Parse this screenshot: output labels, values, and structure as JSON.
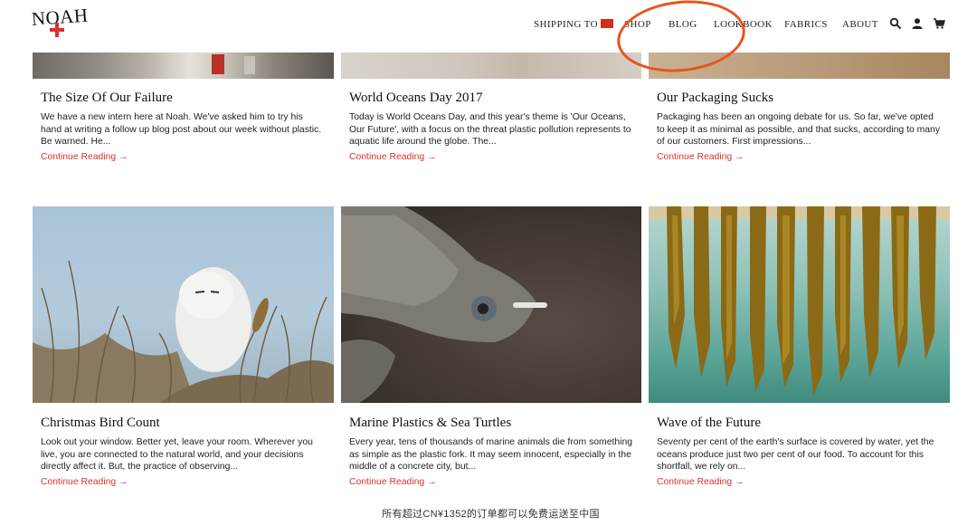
{
  "header": {
    "logo_text": "NOAH",
    "nav": {
      "shipping": "SHIPPING TO",
      "shop": "SHOP",
      "blog": "BLOG",
      "lookbook": "LOOKBOOK",
      "fabrics": "FABRICS",
      "about": "ABOUT"
    },
    "icons": [
      "search-icon",
      "account-icon",
      "cart-icon"
    ],
    "flag_color": "#d52b1e",
    "highlight_color": "#e8541d"
  },
  "articles_top": [
    {
      "title": "The Size Of Our Failure",
      "excerpt": "We have a new intern here at Noah. We've asked him to try his hand at writing a follow up blog post about our week without plastic. Be warned. He...",
      "read_more": "Continue Reading →"
    },
    {
      "title": "World Oceans Day 2017",
      "excerpt": "Today is World Oceans Day, and this year's theme is 'Our Oceans, Our Future', with a focus on the threat plastic pollution represents to aquatic life around the globe. The...",
      "read_more": "Continue Reading →"
    },
    {
      "title": "Our Packaging Sucks",
      "excerpt": "Packaging has been an ongoing debate for us. So far, we've opted to keep it as minimal as possible, and that sucks, according to many of our customers. First impressions...",
      "read_more": "Continue Reading →"
    }
  ],
  "articles_bottom": [
    {
      "title": "Christmas Bird Count",
      "excerpt": "Look out your window. Better yet, leave your room. Wherever you live, you are connected to the natural world, and your decisions directly affect it. But, the practice of observing...",
      "read_more": "Continue Reading →"
    },
    {
      "title": "Marine Plastics & Sea Turtles",
      "excerpt": "Every year, tens of thousands of marine animals die from something as simple as the plastic fork. It may seem innocent, especially in the middle of a concrete city, but...",
      "read_more": "Continue Reading →"
    },
    {
      "title": "Wave of the Future",
      "excerpt": "Seventy per cent of the earth's surface is covered by water, yet the oceans produce just two per cent of our food. To account for this shortfall, we rely on...",
      "read_more": "Continue Reading →"
    }
  ],
  "footer_note": "所有超过CN¥1352的订单都可以免费运送至中国",
  "colors": {
    "accent_link": "#d9322d",
    "logo_cross": "#d9322d"
  }
}
